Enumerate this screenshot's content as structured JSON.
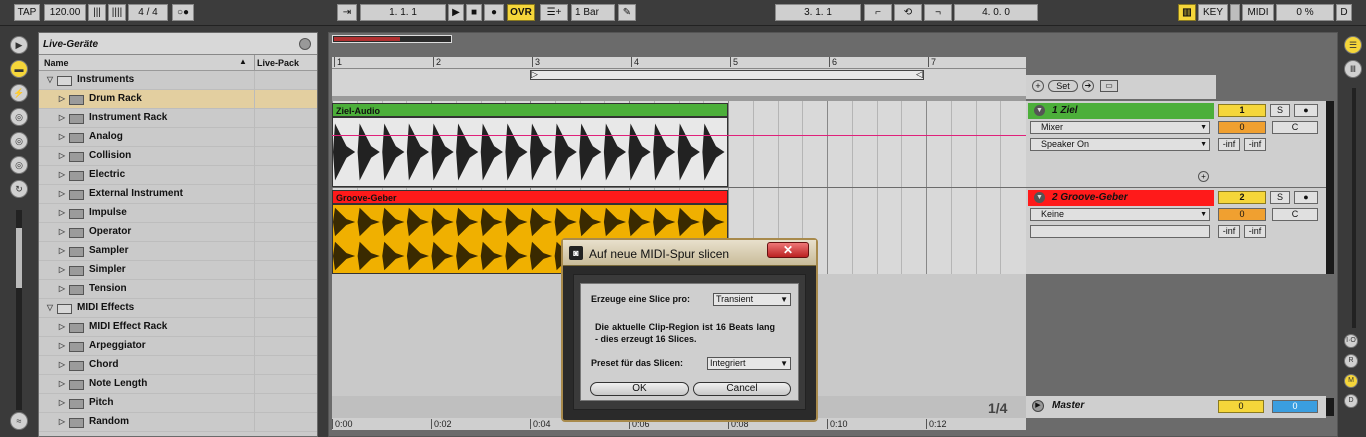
{
  "transport": {
    "tap": "TAP",
    "tempo": "120.00",
    "signature": "4 / 4",
    "position": "1.   1.   1",
    "ovr": "OVR",
    "quant": "1 Bar",
    "loop_start": "3.   1.   1",
    "loop_length": "4.   0.   0",
    "key": "KEY",
    "midi": "MIDI",
    "cpu": "0 %",
    "d": "D"
  },
  "browser": {
    "title": "Live-Geräte",
    "col_name": "Name",
    "col_pack": "Live-Pack",
    "items": [
      {
        "label": "Instruments",
        "level": 0,
        "folder": true
      },
      {
        "label": "Drum Rack",
        "level": 1,
        "selected": true
      },
      {
        "label": "Instrument Rack",
        "level": 1
      },
      {
        "label": "Analog",
        "level": 1
      },
      {
        "label": "Collision",
        "level": 1
      },
      {
        "label": "Electric",
        "level": 1
      },
      {
        "label": "External Instrument",
        "level": 1
      },
      {
        "label": "Impulse",
        "level": 1
      },
      {
        "label": "Operator",
        "level": 1
      },
      {
        "label": "Sampler",
        "level": 1
      },
      {
        "label": "Simpler",
        "level": 1
      },
      {
        "label": "Tension",
        "level": 1
      },
      {
        "label": "MIDI Effects",
        "level": 0,
        "folder": true
      },
      {
        "label": "MIDI Effect Rack",
        "level": 1
      },
      {
        "label": "Arpeggiator",
        "level": 1
      },
      {
        "label": "Chord",
        "level": 1
      },
      {
        "label": "Note Length",
        "level": 1
      },
      {
        "label": "Pitch",
        "level": 1
      },
      {
        "label": "Random",
        "level": 1
      }
    ]
  },
  "ruler": {
    "bars": [
      "1",
      "2",
      "3",
      "4",
      "5",
      "6",
      "7"
    ]
  },
  "timeline": {
    "times": [
      "0:00",
      "0:02",
      "0:04",
      "0:06",
      "0:08",
      "0:10",
      "0:12"
    ],
    "page": "1/4"
  },
  "tracks": [
    {
      "clip": "Ziel-Audio",
      "name": "1 Ziel",
      "number": "1",
      "input": "Mixer",
      "output": "Speaker On",
      "vol": "0",
      "pan": "C",
      "inf1": "-inf",
      "inf2": "-inf",
      "color": "#4caf3a"
    },
    {
      "clip": "Groove-Geber",
      "name": "2 Groove-Geber",
      "number": "2",
      "input": "Keine",
      "output": "",
      "vol": "0",
      "pan": "C",
      "inf1": "-inf",
      "inf2": "-inf",
      "color": "#ff1a1a"
    }
  ],
  "master": {
    "name": "Master",
    "vol": "0",
    "pan": "0"
  },
  "mixer_hdr": {
    "set": "Set"
  },
  "solo": "S",
  "dialog": {
    "title": "Auf neue MIDI-Spur slicen",
    "slice_label": "Erzeuge eine Slice pro:",
    "slice_value": "Transient",
    "info": "Die aktuelle Clip-Region ist 16 Beats lang - dies erzeugt 16 Slices.",
    "preset_label": "Preset für das Slicen:",
    "preset_value": "Integriert",
    "ok": "OK",
    "cancel": "Cancel"
  },
  "right": {
    "io": "I·O",
    "r": "R",
    "m": "M",
    "d": "D"
  },
  "colors": {
    "yellow": "#f5d63a",
    "audio_clip": "#4caf3a",
    "groove_clip": "#ff1a1a",
    "wave_bg": "#f0b000"
  }
}
